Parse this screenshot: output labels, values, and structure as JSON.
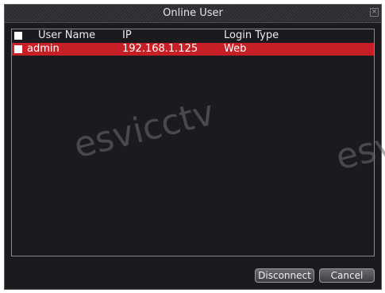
{
  "window": {
    "title": "Online User",
    "close_glyph": "×"
  },
  "table": {
    "columns": {
      "name": "User Name",
      "ip": "IP",
      "login_type": "Login Type"
    },
    "rows": [
      {
        "name": "admin",
        "ip": "192.168.1.125",
        "login_type": "Web",
        "selected": true
      }
    ]
  },
  "watermark": {
    "text_1": "esvicctv",
    "text_2": "esv"
  },
  "buttons": {
    "disconnect": "Disconnect",
    "cancel": "Cancel"
  },
  "colors": {
    "selected_row": "#c61f26",
    "background": "#1b1b1f"
  }
}
